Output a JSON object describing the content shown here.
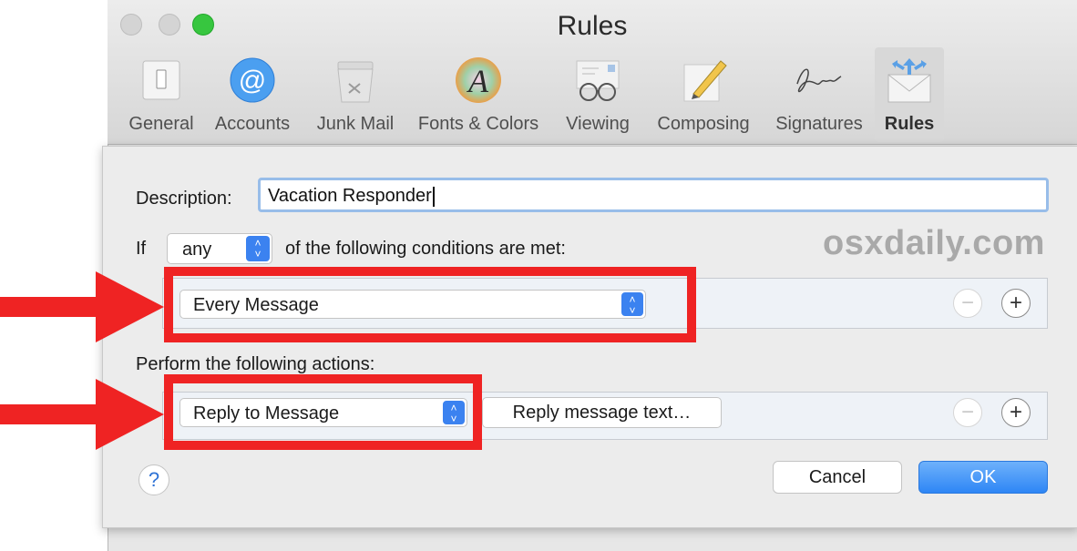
{
  "window": {
    "title": "Rules",
    "colors": {
      "accent": "#3b82f0",
      "highlight": "#ef2323",
      "zoom_button": "#37c63f"
    }
  },
  "toolbar": {
    "tabs": [
      {
        "label": "General",
        "icon": "general-switch-icon"
      },
      {
        "label": "Accounts",
        "icon": "at-sign-icon"
      },
      {
        "label": "Junk Mail",
        "icon": "trash-bin-icon"
      },
      {
        "label": "Fonts & Colors",
        "icon": "font-color-icon"
      },
      {
        "label": "Viewing",
        "icon": "glasses-letter-icon"
      },
      {
        "label": "Composing",
        "icon": "pencil-icon"
      },
      {
        "label": "Signatures",
        "icon": "signature-icon"
      },
      {
        "label": "Rules",
        "icon": "envelope-arrows-icon",
        "active": true
      }
    ]
  },
  "rule": {
    "description_label": "Description:",
    "description_value": "Vacation Responder",
    "if_label": "If",
    "match_select": "any",
    "conditions_label": "of the following conditions are met:",
    "condition_value": "Every Message",
    "actions_label": "Perform the following actions:",
    "action_value": "Reply to Message",
    "reply_text_button": "Reply message text…",
    "minus_symbol": "−",
    "plus_symbol": "+"
  },
  "footer": {
    "help_symbol": "?",
    "cancel_label": "Cancel",
    "ok_label": "OK"
  },
  "watermark": "osxdaily.com"
}
